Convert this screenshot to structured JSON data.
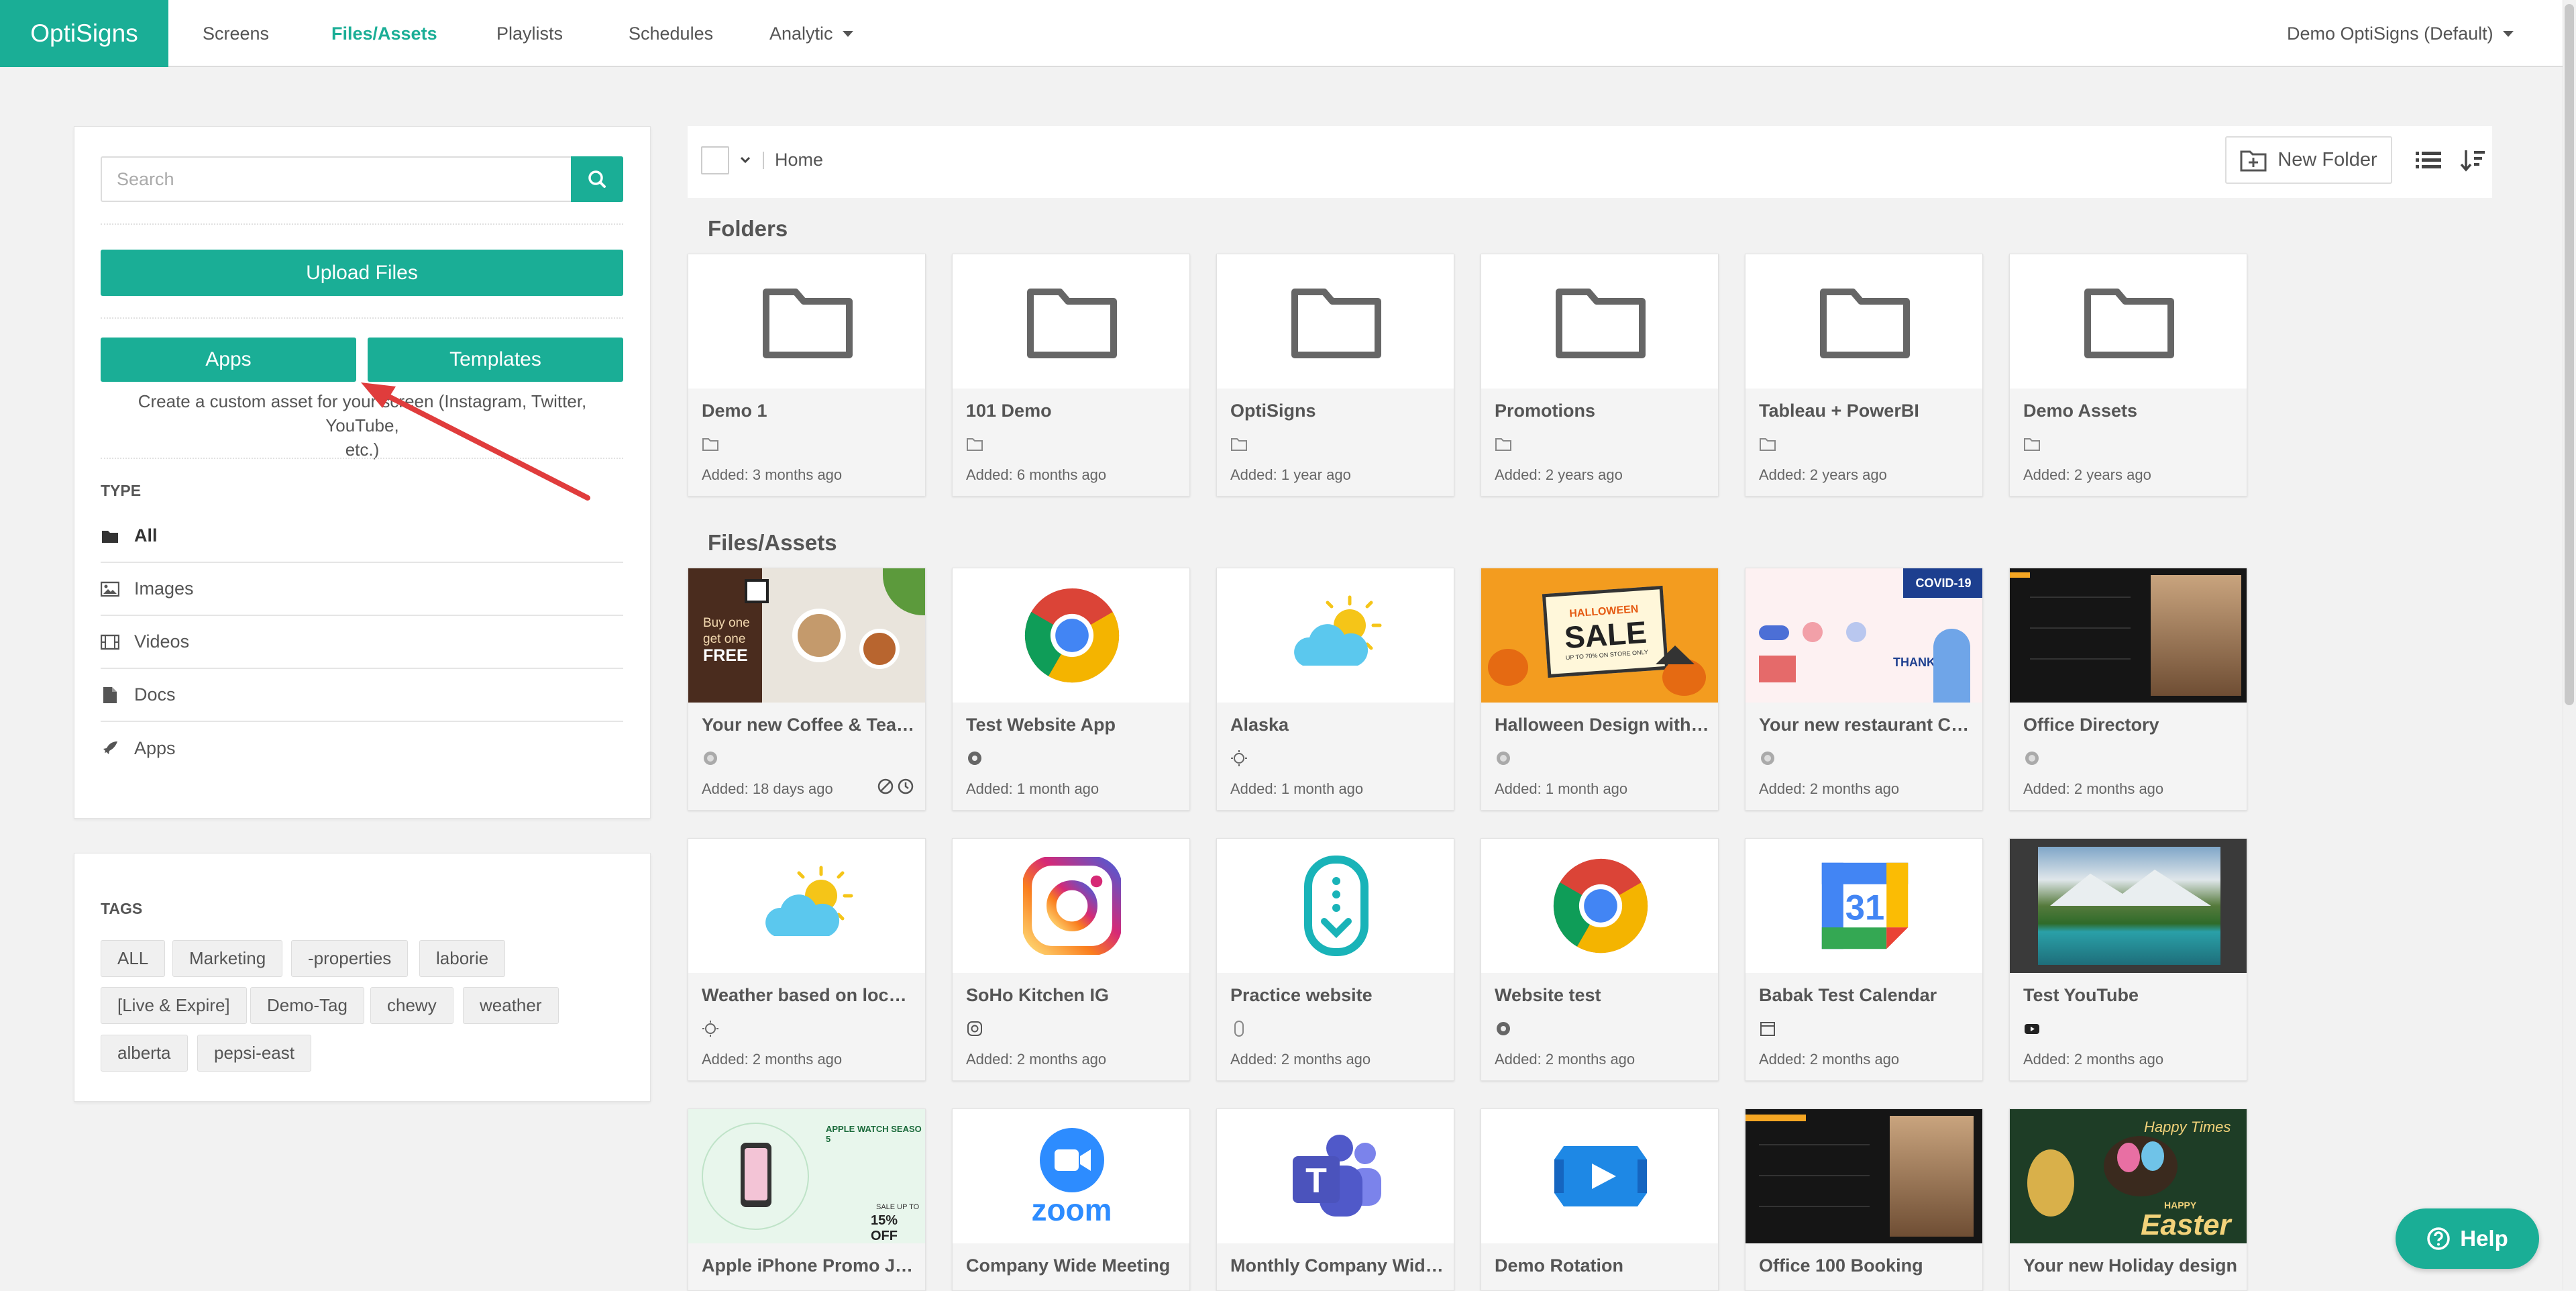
{
  "app": {
    "brand": "OptiSigns",
    "brand_color": "#1aae96"
  },
  "nav": {
    "items": [
      "Screens",
      "Files/Assets",
      "Playlists",
      "Schedules",
      "Analytic"
    ],
    "active": "Files/Assets",
    "account": "Demo OptiSigns (Default)"
  },
  "sidebar": {
    "search_placeholder": "Search",
    "upload_label": "Upload Files",
    "apps_label": "Apps",
    "templates_label": "Templates",
    "hint_line1": "Create a custom asset for your screen (Instagram, Twitter, YouTube,",
    "hint_line2": "etc.)",
    "type_title": "TYPE",
    "types": [
      {
        "label": "All",
        "icon": "folder-icon"
      },
      {
        "label": "Images",
        "icon": "image-icon"
      },
      {
        "label": "Videos",
        "icon": "film-icon"
      },
      {
        "label": "Docs",
        "icon": "document-icon"
      },
      {
        "label": "Apps",
        "icon": "rocket-icon"
      }
    ],
    "tags_title": "TAGS",
    "tags": [
      "ALL",
      "Marketing",
      "-properties",
      "laborie",
      "[Live & Expire]",
      "Demo-Tag",
      "chewy",
      "weather",
      "alberta",
      "pepsi-east"
    ]
  },
  "toolbar": {
    "breadcrumb": "Home",
    "new_folder_label": "New Folder"
  },
  "sections": {
    "folders_title": "Folders",
    "files_title": "Files/Assets"
  },
  "folders": [
    {
      "name": "Demo 1",
      "added": "Added: 3 months ago"
    },
    {
      "name": "101 Demo",
      "added": "Added: 6 months ago"
    },
    {
      "name": "OptiSigns",
      "added": "Added: 1 year ago"
    },
    {
      "name": "Promotions",
      "added": "Added: 2 years ago"
    },
    {
      "name": "Tableau + PowerBI",
      "added": "Added: 2 years ago"
    },
    {
      "name": "Demo Assets",
      "added": "Added: 2 years ago"
    }
  ],
  "assets_row1": [
    {
      "name": "Your new Coffee & Tea de...",
      "added": "Added: 18 days ago",
      "thumb": "coffee-promo-thumbnail",
      "promo_line1": "Buy one",
      "promo_line2": "get one",
      "promo_line3": "FREE"
    },
    {
      "name": "Test Website App",
      "added": "Added: 1 month ago",
      "thumb": "chrome-logo-thumbnail"
    },
    {
      "name": "Alaska",
      "added": "Added: 1 month ago",
      "thumb": "weather-thumbnail"
    },
    {
      "name": "Halloween Design with ani...",
      "added": "Added: 1 month ago",
      "thumb": "halloween-sale-thumbnail",
      "banner_top": "HALLOWEEN",
      "banner_main": "SALE",
      "banner_sub": "UP TO 70% ON STORE ONLY"
    },
    {
      "name": "Your new restaurant Covid...",
      "added": "Added: 2 months ago",
      "thumb": "covid-restaurant-thumbnail",
      "banner": "COVID-19",
      "note": "THANKS!"
    },
    {
      "name": "Office Directory",
      "added": "Added: 2 months ago",
      "thumb": "office-directory-thumbnail"
    }
  ],
  "assets_row2": [
    {
      "name": "Weather based on location",
      "added": "Added: 2 months ago",
      "thumb": "weather-thumbnail"
    },
    {
      "name": "SoHo Kitchen IG",
      "added": "Added: 2 months ago",
      "thumb": "instagram-logo-thumbnail"
    },
    {
      "name": "Practice website",
      "added": "Added: 2 months ago",
      "thumb": "scroll-app-thumbnail"
    },
    {
      "name": "Website test",
      "added": "Added: 2 months ago",
      "thumb": "chrome-logo-thumbnail"
    },
    {
      "name": "Babak Test Calendar",
      "added": "Added: 2 months ago",
      "thumb": "google-calendar-thumbnail",
      "calendar_day": "31"
    },
    {
      "name": "Test YouTube",
      "added": "Added: 2 months ago",
      "thumb": "mountain-lake-thumbnail"
    }
  ],
  "assets_row3": [
    {
      "name": "Apple iPhone Promo July",
      "thumb": "iphone-promo-thumbnail",
      "headline": "APPLE WATCH SEASO 5",
      "sale": "SALE UP TO",
      "sale_pct": "15% OFF"
    },
    {
      "name": "Company Wide Meeting",
      "thumb": "zoom-logo-thumbnail",
      "logo_text": "zoom"
    },
    {
      "name": "Monthly Company Wide U...",
      "thumb": "teams-logo-thumbnail"
    },
    {
      "name": "Demo Rotation",
      "thumb": "rotation-logo-thumbnail"
    },
    {
      "name": "Office 100 Booking",
      "thumb": "office-booking-thumbnail"
    },
    {
      "name": "Your new Holiday design",
      "thumb": "easter-thumbnail",
      "line1": "Happy Times",
      "line2": "HAPPY",
      "line3": "Easter"
    }
  ],
  "help_label": "Help",
  "colors": {
    "accent": "#1aae96",
    "annotation_arrow": "#e03c3c"
  }
}
